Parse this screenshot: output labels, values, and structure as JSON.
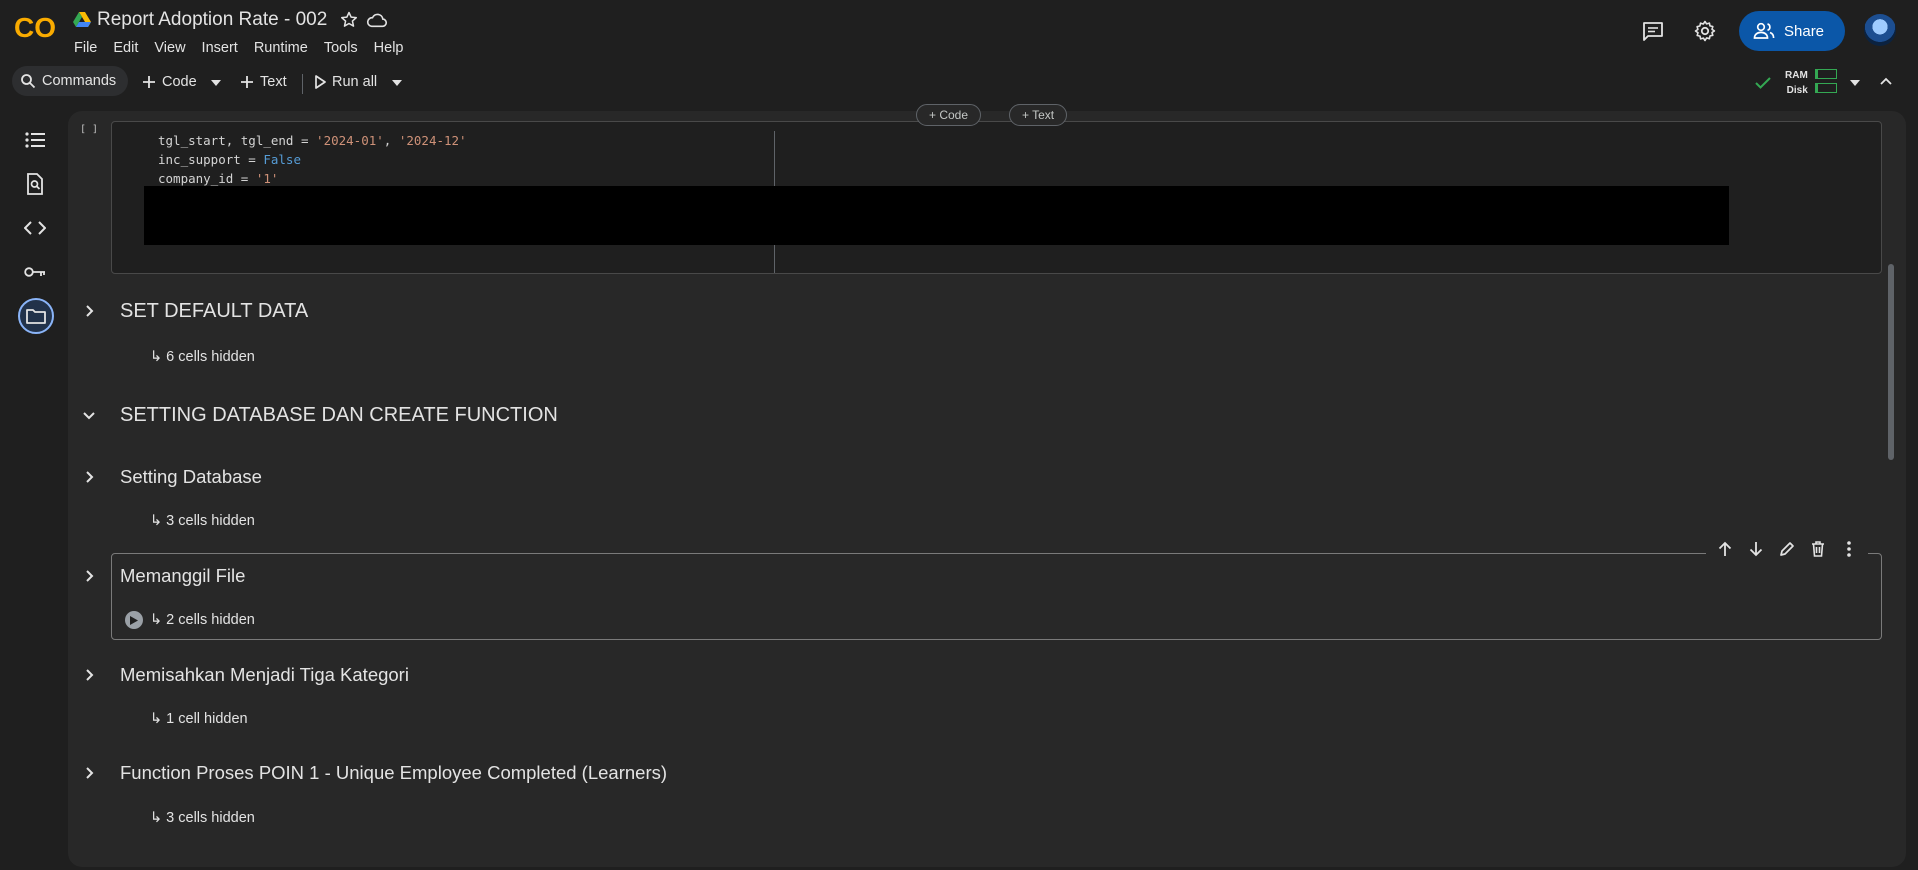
{
  "app": {
    "title": "Report Adoption Rate - 002",
    "logo_text": "CO",
    "menu": [
      "File",
      "Edit",
      "View",
      "Insert",
      "Runtime",
      "Tools",
      "Help"
    ],
    "share_label": "Share"
  },
  "toolbar": {
    "commands_label": "Commands",
    "code_label": "Code",
    "text_label": "Text",
    "run_all_label": "Run all",
    "ram_label": "RAM",
    "disk_label": "Disk"
  },
  "code_cell": {
    "run_indicator": "[ ]",
    "lines": [
      {
        "a": "tgl_start, tgl_end = ",
        "b": "'2024-01'",
        "c": ", ",
        "d": "'2024-12'"
      },
      {
        "a": "inc_support = ",
        "b": "False"
      },
      {
        "a": "company_id = ",
        "b": "'1'"
      }
    ],
    "add_code_label": "+ Code",
    "add_text_label": "+ Text"
  },
  "sections": [
    {
      "title": "SET DEFAULT DATA",
      "hidden": "↳ 6 cells hidden",
      "expanded": false
    },
    {
      "title": "SETTING DATABASE DAN CREATE FUNCTION",
      "expanded": true
    },
    {
      "title": "Setting Database",
      "hidden": "↳ 3 cells hidden",
      "expanded": false
    },
    {
      "title": "Memanggil File",
      "hidden": "↳ 2 cells hidden",
      "expanded": false,
      "selected": true
    },
    {
      "title": "Memisahkan Menjadi Tiga Kategori",
      "hidden": "↳ 1 cell hidden",
      "expanded": false
    },
    {
      "title": "Function Proses POIN 1 - Unique Employee Completed (Learners)",
      "hidden": "↳ 3 cells hidden",
      "expanded": false
    }
  ],
  "colors": {
    "accent": "#0b57a8",
    "logo_orange": "#f9ab00",
    "string": "#ce9178",
    "keyword": "#569cd6"
  },
  "icons": [
    "drive-icon",
    "star-icon",
    "cloud-icon",
    "comment-icon",
    "gear-icon",
    "people-icon",
    "search-icon",
    "plus-icon",
    "play-icon",
    "check-icon",
    "toc-icon",
    "find-icon",
    "code-icon",
    "key-icon",
    "folder-icon",
    "arrow-up-icon",
    "arrow-down-icon",
    "pencil-icon",
    "trash-icon",
    "more-vert-icon"
  ]
}
